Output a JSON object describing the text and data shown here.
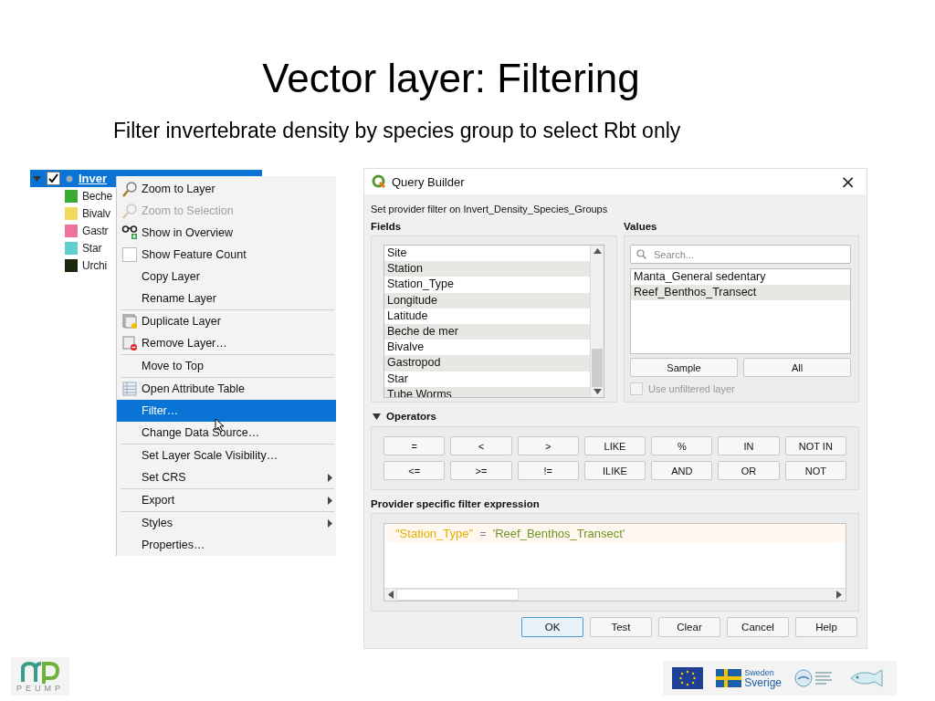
{
  "slide": {
    "title": "Vector layer: Filtering",
    "subtitle": "Filter invertebrate density by species group to select Rbt only"
  },
  "layers_panel": {
    "layer": {
      "name": "Inver",
      "checked": true,
      "selected": true
    },
    "legend": [
      {
        "label": "Beche",
        "color": "#3aaa35"
      },
      {
        "label": "Bivalv",
        "color": "#f2d95c"
      },
      {
        "label": "Gastr",
        "color": "#ee7399"
      },
      {
        "label": "Star",
        "color": "#5ccfcf"
      },
      {
        "label": "Urchi",
        "color": "#1b2a0f"
      }
    ]
  },
  "context_menu": {
    "groups": [
      [
        {
          "label": "Zoom to Layer",
          "disabled": false,
          "selected": false,
          "submenu": false
        },
        {
          "label": "Zoom to Selection",
          "disabled": true,
          "selected": false,
          "submenu": false
        },
        {
          "label": "Show in Overview",
          "disabled": false,
          "selected": false,
          "submenu": false
        },
        {
          "label": "Show Feature Count",
          "kind": "checkbox",
          "checked": false,
          "disabled": false,
          "selected": false,
          "submenu": false
        },
        {
          "label": "Copy Layer",
          "disabled": false,
          "selected": false,
          "submenu": false
        },
        {
          "label": "Rename Layer",
          "disabled": false,
          "selected": false,
          "submenu": false
        }
      ],
      [
        {
          "label": "Duplicate Layer",
          "disabled": false,
          "selected": false,
          "submenu": false
        },
        {
          "label": "Remove Layer…",
          "disabled": false,
          "selected": false,
          "submenu": false
        }
      ],
      [
        {
          "label": "Move to Top",
          "disabled": false,
          "selected": false,
          "submenu": false
        }
      ],
      [
        {
          "label": "Open Attribute Table",
          "disabled": false,
          "selected": false,
          "submenu": false
        },
        {
          "label": "Filter…",
          "disabled": false,
          "selected": true,
          "submenu": false
        },
        {
          "label": "Change Data Source…",
          "disabled": false,
          "selected": false,
          "submenu": false
        }
      ],
      [
        {
          "label": "Set Layer Scale Visibility…",
          "disabled": false,
          "selected": false,
          "submenu": false
        },
        {
          "label": "Set CRS",
          "disabled": false,
          "selected": false,
          "submenu": true
        }
      ],
      [
        {
          "label": "Export",
          "disabled": false,
          "selected": false,
          "submenu": true
        }
      ],
      [
        {
          "label": "Styles",
          "disabled": false,
          "selected": false,
          "submenu": true
        },
        {
          "label": "Properties…",
          "disabled": false,
          "selected": false,
          "submenu": false
        }
      ]
    ]
  },
  "dialog": {
    "title": "Query Builder",
    "close": "×",
    "description": "Set provider filter on Invert_Density_Species_Groups",
    "fields": {
      "heading": "Fields",
      "items": [
        {
          "label": "Site",
          "selected": false
        },
        {
          "label": "Station",
          "selected": false
        },
        {
          "label": "Station_Type",
          "selected": false
        },
        {
          "label": "Longitude",
          "selected": false
        },
        {
          "label": "Latitude",
          "selected": false
        },
        {
          "label": "Beche de mer",
          "selected": false
        },
        {
          "label": "Bivalve",
          "selected": false
        },
        {
          "label": "Gastropod",
          "selected": false
        },
        {
          "label": "Star",
          "selected": false
        },
        {
          "label": "Tube Worms",
          "selected": false
        }
      ]
    },
    "values": {
      "heading": "Values",
      "search": {
        "placeholder": "Search..."
      },
      "items": [
        {
          "label": "Manta_General sedentary",
          "selected": false
        },
        {
          "label": "Reef_Benthos_Transect",
          "selected": false
        }
      ],
      "buttons": [
        "Sample",
        "All"
      ],
      "use_unfiltered": {
        "label": "Use unfiltered layer",
        "checked": false,
        "disabled": true
      }
    },
    "operators": {
      "heading": "Operators",
      "expanded": true,
      "buttons": [
        "=",
        "<",
        ">",
        "LIKE",
        "%",
        "IN",
        "NOT IN",
        "<=",
        ">=",
        "!=",
        "ILIKE",
        "AND",
        "OR",
        "NOT"
      ]
    },
    "expression": {
      "heading": "Provider specific filter expression",
      "tokens": [
        {
          "text": "\"Station_Type\"",
          "kind": "field"
        },
        {
          "text": "=",
          "kind": "operator"
        },
        {
          "text": "'Reef_Benthos_Transect'",
          "kind": "string"
        }
      ]
    },
    "buttons": [
      {
        "label": "OK",
        "default": true
      },
      {
        "label": "Test",
        "default": false
      },
      {
        "label": "Clear",
        "default": false
      },
      {
        "label": "Cancel",
        "default": false
      },
      {
        "label": "Help",
        "default": false
      }
    ]
  },
  "footer": {
    "left_logo": "PEUMP",
    "sweden": {
      "country": "Sweden",
      "brand": "Sverige"
    }
  }
}
